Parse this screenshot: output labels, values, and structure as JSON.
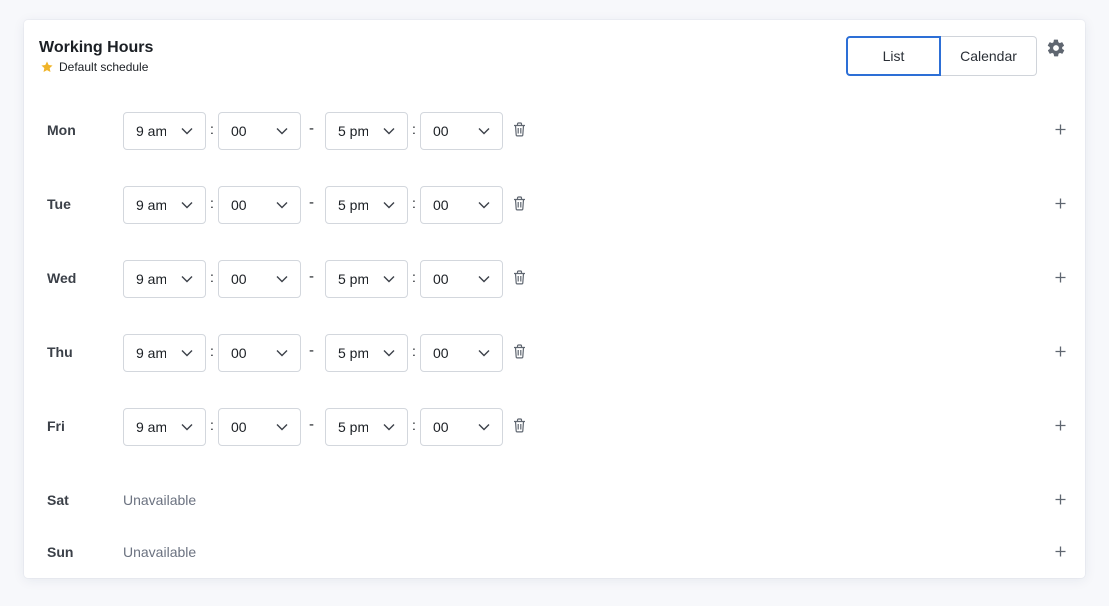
{
  "header": {
    "title": "Working Hours",
    "subtitle": "Default schedule",
    "icons": {
      "subtitle_icon": "star-icon",
      "settings_icon": "gear-icon"
    },
    "accent_star": "#f0b429"
  },
  "view_toggle": {
    "options": [
      "List",
      "Calendar"
    ],
    "selected": "List",
    "accent": "#2d6fd6"
  },
  "separators": {
    "colon": ":",
    "dash": "-"
  },
  "days": [
    {
      "day": "Mon",
      "start_hour": "9 am",
      "start_min": "00",
      "end_hour": "5 pm",
      "end_min": "00"
    },
    {
      "day": "Tue",
      "start_hour": "9 am",
      "start_min": "00",
      "end_hour": "5 pm",
      "end_min": "00"
    },
    {
      "day": "Wed",
      "start_hour": "9 am",
      "start_min": "00",
      "end_hour": "5 pm",
      "end_min": "00"
    },
    {
      "day": "Thu",
      "start_hour": "9 am",
      "start_min": "00",
      "end_hour": "5 pm",
      "end_min": "00"
    },
    {
      "day": "Fri",
      "start_hour": "9 am",
      "start_min": "00",
      "end_hour": "5 pm",
      "end_min": "00"
    },
    {
      "day": "Sat",
      "status": "Unavailable"
    },
    {
      "day": "Sun",
      "status": "Unavailable"
    }
  ]
}
